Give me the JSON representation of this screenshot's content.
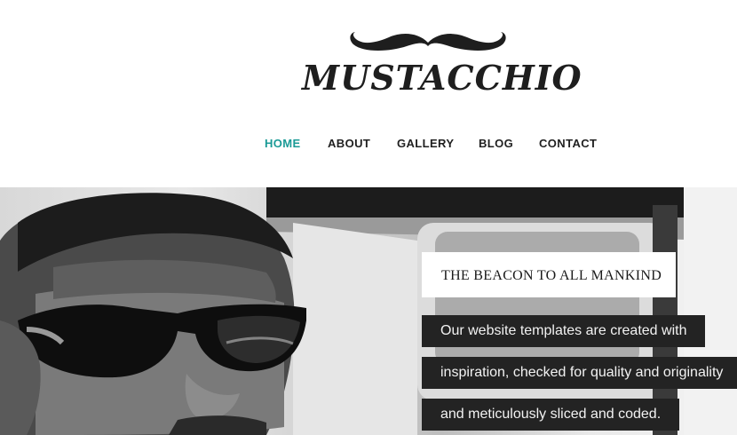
{
  "header": {
    "logo_text": "MUSTACCHIO"
  },
  "nav": {
    "items": [
      {
        "label": "HOME",
        "active": true
      },
      {
        "label": "ABOUT",
        "active": false
      },
      {
        "label": "GALLERY",
        "active": false
      },
      {
        "label": "BLOG",
        "active": false
      },
      {
        "label": "CONTACT",
        "active": false
      }
    ]
  },
  "hero": {
    "title": "THE BEACON TO ALL MANKIND",
    "lines": [
      "Our website templates are created with",
      "inspiration, checked for quality and originality",
      "and meticulously sliced and coded."
    ]
  },
  "colors": {
    "accent": "#1a9a96",
    "text": "#1f1f1f",
    "banner_bg": "#232323"
  },
  "icons": [
    "mustache-logo-icon"
  ]
}
